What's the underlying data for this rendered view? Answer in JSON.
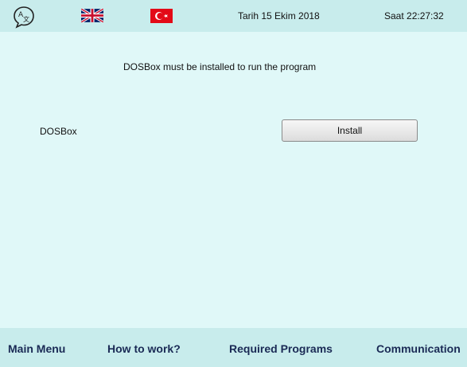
{
  "header": {
    "date": "Tarih 15 Ekim 2018",
    "time": "Saat 22:27:32",
    "icons": {
      "language": "translate-icon",
      "english": "uk-flag-icon",
      "turkish": "turkey-flag-icon"
    }
  },
  "main": {
    "message": "DOSBox must be installed to run the program",
    "program_label": "DOSBox",
    "install_label": "Install"
  },
  "footer": {
    "items": [
      {
        "label": "Main Menu"
      },
      {
        "label": "How to work?"
      },
      {
        "label": "Required Programs"
      },
      {
        "label": "Communication"
      }
    ]
  },
  "colors": {
    "background": "#e0f8f8",
    "bars": "#c8ecec",
    "nav_text": "#1a2a55",
    "turkish_red": "#e30a17"
  }
}
